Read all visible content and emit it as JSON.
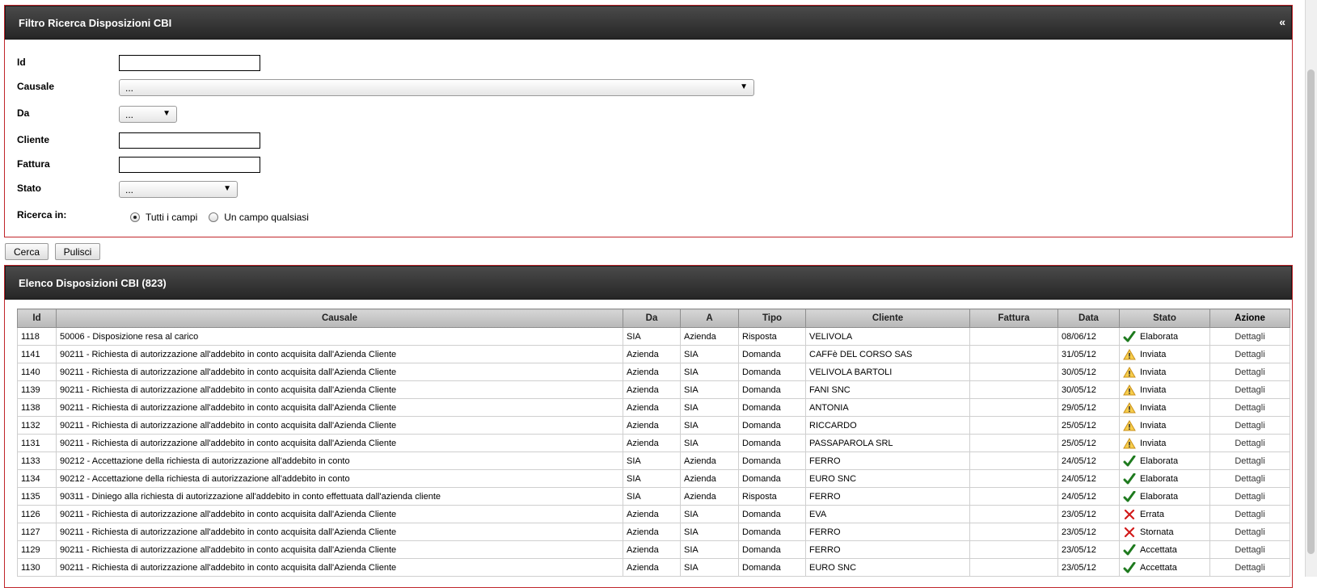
{
  "filter": {
    "title": "Filtro Ricerca Disposizioni CBI",
    "collapse_glyph": "«",
    "id_label": "Id",
    "id_value": "",
    "causale_label": "Causale",
    "causale_value": "...",
    "da_label": "Da",
    "da_value": "...",
    "cliente_label": "Cliente",
    "cliente_value": "",
    "fattura_label": "Fattura",
    "fattura_value": "",
    "stato_label": "Stato",
    "stato_value": "...",
    "ricerca_label": "Ricerca in:",
    "radio_tutti": "Tutti i campi",
    "radio_uno": "Un campo qualsiasi",
    "selected_radio": "tutti"
  },
  "buttons": {
    "cerca": "Cerca",
    "pulisci": "Pulisci"
  },
  "list": {
    "title": "Elenco Disposizioni CBI (823)",
    "columns": [
      "Id",
      "Causale",
      "Da",
      "A",
      "Tipo",
      "Cliente",
      "Fattura",
      "Data",
      "Stato",
      "Azione"
    ],
    "rows": [
      {
        "id": "1118",
        "causale": "50006 - Disposizione resa al carico",
        "da": "SIA",
        "a": "Azienda",
        "tipo": "Risposta",
        "cliente": "VELIVOLA",
        "fattura": "",
        "data": "08/06/12",
        "stato": "Elaborata",
        "icon": "check-icon",
        "azione": "Dettagli"
      },
      {
        "id": "1141",
        "causale": "90211 - Richiesta di autorizzazione all'addebito in conto acquisita dall'Azienda Cliente",
        "da": "Azienda",
        "a": "SIA",
        "tipo": "Domanda",
        "cliente": "CAFFè DEL CORSO SAS",
        "fattura": "",
        "data": "31/05/12",
        "stato": "Inviata",
        "icon": "warning-icon",
        "azione": "Dettagli"
      },
      {
        "id": "1140",
        "causale": "90211 - Richiesta di autorizzazione all'addebito in conto acquisita dall'Azienda Cliente",
        "da": "Azienda",
        "a": "SIA",
        "tipo": "Domanda",
        "cliente": "VELIVOLA BARTOLI",
        "fattura": "",
        "data": "30/05/12",
        "stato": "Inviata",
        "icon": "warning-icon",
        "azione": "Dettagli"
      },
      {
        "id": "1139",
        "causale": "90211 - Richiesta di autorizzazione all'addebito in conto acquisita dall'Azienda Cliente",
        "da": "Azienda",
        "a": "SIA",
        "tipo": "Domanda",
        "cliente": "FANI SNC",
        "fattura": "",
        "data": "30/05/12",
        "stato": "Inviata",
        "icon": "warning-icon",
        "azione": "Dettagli"
      },
      {
        "id": "1138",
        "causale": "90211 - Richiesta di autorizzazione all'addebito in conto acquisita dall'Azienda Cliente",
        "da": "Azienda",
        "a": "SIA",
        "tipo": "Domanda",
        "cliente": "ANTONIA",
        "fattura": "",
        "data": "29/05/12",
        "stato": "Inviata",
        "icon": "warning-icon",
        "azione": "Dettagli"
      },
      {
        "id": "1132",
        "causale": "90211 - Richiesta di autorizzazione all'addebito in conto acquisita dall'Azienda Cliente",
        "da": "Azienda",
        "a": "SIA",
        "tipo": "Domanda",
        "cliente": "RICCARDO",
        "fattura": "",
        "data": "25/05/12",
        "stato": "Inviata",
        "icon": "warning-icon",
        "azione": "Dettagli"
      },
      {
        "id": "1131",
        "causale": "90211 - Richiesta di autorizzazione all'addebito in conto acquisita dall'Azienda Cliente",
        "da": "Azienda",
        "a": "SIA",
        "tipo": "Domanda",
        "cliente": "PASSAPAROLA SRL",
        "fattura": "",
        "data": "25/05/12",
        "stato": "Inviata",
        "icon": "warning-icon",
        "azione": "Dettagli"
      },
      {
        "id": "1133",
        "causale": "90212 - Accettazione della richiesta di autorizzazione all'addebito in conto",
        "da": "SIA",
        "a": "Azienda",
        "tipo": "Domanda",
        "cliente": "FERRO",
        "fattura": "",
        "data": "24/05/12",
        "stato": "Elaborata",
        "icon": "check-icon",
        "azione": "Dettagli"
      },
      {
        "id": "1134",
        "causale": "90212 - Accettazione della richiesta di autorizzazione all'addebito in conto",
        "da": "SIA",
        "a": "Azienda",
        "tipo": "Domanda",
        "cliente": "EURO SNC",
        "fattura": "",
        "data": "24/05/12",
        "stato": "Elaborata",
        "icon": "check-icon",
        "azione": "Dettagli"
      },
      {
        "id": "1135",
        "causale": "90311 - Diniego alla richiesta di autorizzazione all'addebito in conto effettuata dall'azienda cliente",
        "da": "SIA",
        "a": "Azienda",
        "tipo": "Risposta",
        "cliente": "FERRO",
        "fattura": "",
        "data": "24/05/12",
        "stato": "Elaborata",
        "icon": "check-icon",
        "azione": "Dettagli"
      },
      {
        "id": "1126",
        "causale": "90211 - Richiesta di autorizzazione all'addebito in conto acquisita dall'Azienda Cliente",
        "da": "Azienda",
        "a": "SIA",
        "tipo": "Domanda",
        "cliente": "EVA",
        "fattura": "",
        "data": "23/05/12",
        "stato": "Errata",
        "icon": "cross-icon",
        "azione": "Dettagli"
      },
      {
        "id": "1127",
        "causale": "90211 - Richiesta di autorizzazione all'addebito in conto acquisita dall'Azienda Cliente",
        "da": "Azienda",
        "a": "SIA",
        "tipo": "Domanda",
        "cliente": "FERRO",
        "fattura": "",
        "data": "23/05/12",
        "stato": "Stornata",
        "icon": "cross-icon",
        "azione": "Dettagli"
      },
      {
        "id": "1129",
        "causale": "90211 - Richiesta di autorizzazione all'addebito in conto acquisita dall'Azienda Cliente",
        "da": "Azienda",
        "a": "SIA",
        "tipo": "Domanda",
        "cliente": "FERRO",
        "fattura": "",
        "data": "23/05/12",
        "stato": "Accettata",
        "icon": "check-icon",
        "azione": "Dettagli"
      },
      {
        "id": "1130",
        "causale": "90211 - Richiesta di autorizzazione all'addebito in conto acquisita dall'Azienda Cliente",
        "da": "Azienda",
        "a": "SIA",
        "tipo": "Domanda",
        "cliente": "EURO SNC",
        "fattura": "",
        "data": "23/05/12",
        "stato": "Accettata",
        "icon": "check-icon",
        "azione": "Dettagli"
      }
    ]
  },
  "colors": {
    "panel_border": "#c0262b",
    "header_bg": "#2e2e2e",
    "check": "#1e7a1e",
    "cross": "#d21a1a",
    "warning": "#f2b52b"
  }
}
